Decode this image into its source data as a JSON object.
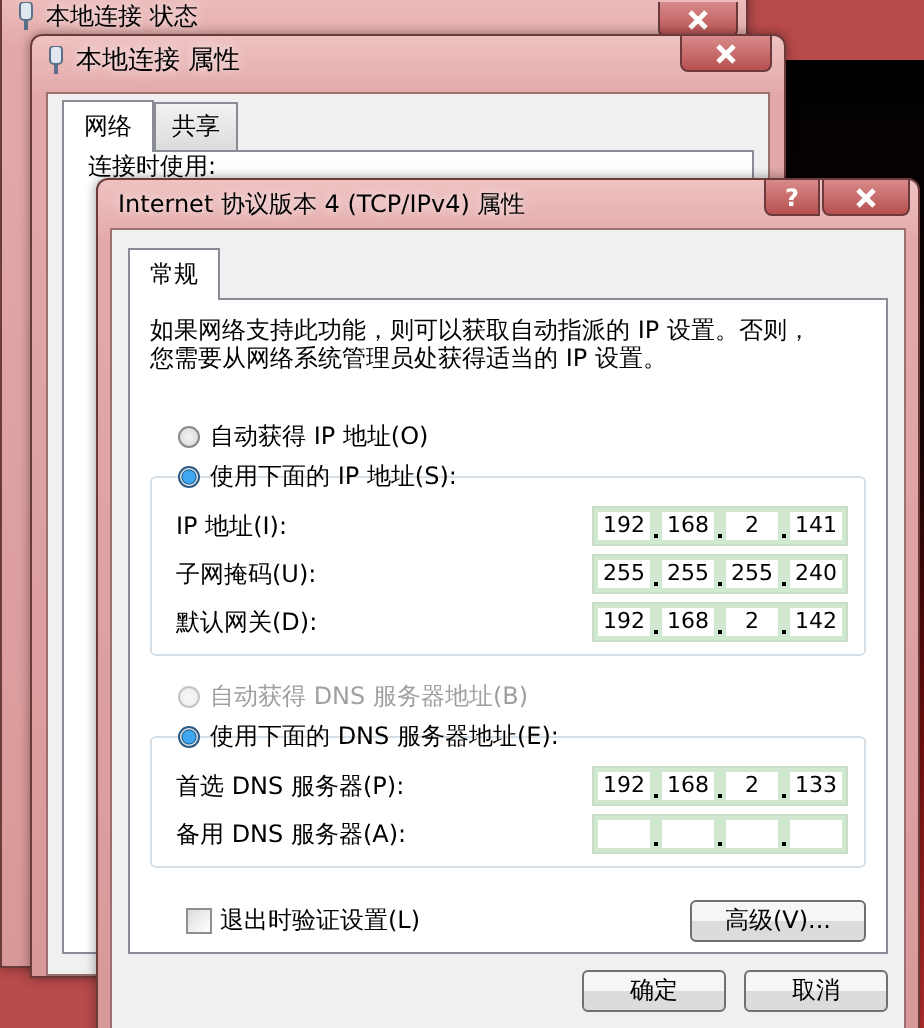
{
  "background_windows": [
    {
      "title": "本地连接 状态"
    },
    {
      "title": "本地连接 属性",
      "tabs": [
        {
          "label": "网络",
          "selected": true
        },
        {
          "label": "共享",
          "selected": false
        }
      ],
      "section_label": "连接时使用:"
    }
  ],
  "dialog": {
    "title": "Internet 协议版本 4 (TCP/IPv4) 属性",
    "help_button": "?",
    "tabs": [
      {
        "label": "常规",
        "selected": true
      }
    ],
    "description": "如果网络支持此功能，则可以获取自动指派的 IP 设置。否则，您需要从网络系统管理员处获得适当的 IP 设置。",
    "ip_options": [
      {
        "label": "自动获得 IP 地址(O)",
        "selected": false,
        "disabled": false
      },
      {
        "label": "使用下面的 IP 地址(S):",
        "selected": true,
        "disabled": false
      }
    ],
    "ip_fields": [
      {
        "label": "IP 地址(I):",
        "octets": [
          "192",
          "168",
          "2",
          "141"
        ]
      },
      {
        "label": "子网掩码(U):",
        "octets": [
          "255",
          "255",
          "255",
          "240"
        ]
      },
      {
        "label": "默认网关(D):",
        "octets": [
          "192",
          "168",
          "2",
          "142"
        ]
      }
    ],
    "dns_options": [
      {
        "label": "自动获得 DNS 服务器地址(B)",
        "selected": false,
        "disabled": true
      },
      {
        "label": "使用下面的 DNS 服务器地址(E):",
        "selected": true,
        "disabled": false
      }
    ],
    "dns_fields": [
      {
        "label": "首选 DNS 服务器(P):",
        "octets": [
          "192",
          "168",
          "2",
          "133"
        ]
      },
      {
        "label": "备用 DNS 服务器(A):"
      }
    ],
    "validate_checkbox": {
      "label": "退出时验证设置(L)",
      "checked": false
    },
    "advanced_button": "高级(V)...",
    "buttons": [
      "确定",
      "取消"
    ]
  }
}
